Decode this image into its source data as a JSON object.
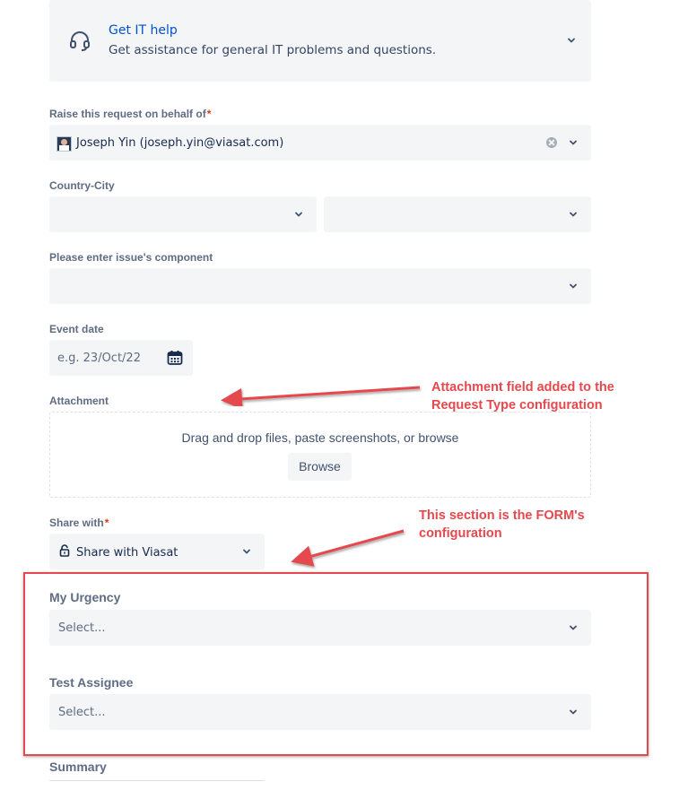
{
  "request_type": {
    "title": "Get IT help",
    "description": "Get assistance for general IT problems and questions.",
    "icon": "headset-icon"
  },
  "on_behalf": {
    "label": "Raise this request on behalf of",
    "required_mark": "*",
    "value": "Joseph Yin (joseph.yin@viasat.com)"
  },
  "country_city": {
    "label": "Country-City"
  },
  "component": {
    "label": "Please enter issue's component"
  },
  "event_date": {
    "label": "Event date",
    "placeholder": "e.g. 23/Oct/22"
  },
  "attachment": {
    "label": "Attachment",
    "dropzone_text": "Drag and drop files, paste screenshots, or browse",
    "browse_label": "Browse"
  },
  "share_with": {
    "label": "Share with",
    "required_mark": "*",
    "value": "Share with Viasat"
  },
  "form": {
    "urgency_label": "My Urgency",
    "urgency_placeholder": "Select...",
    "assignee_label": "Test Assignee",
    "assignee_placeholder": "Select..."
  },
  "summary": {
    "label": "Summary"
  },
  "annotations": {
    "attachment_note_line1": "Attachment field added to the",
    "attachment_note_line2": "Request Type configuration",
    "form_note_line1": "This section is the FORM's",
    "form_note_line2": "configuration",
    "color": "#e5484d"
  },
  "colors": {
    "link": "#0052cc",
    "field_bg": "#f4f5f7",
    "label": "#5e6c84",
    "required": "#de350b"
  }
}
